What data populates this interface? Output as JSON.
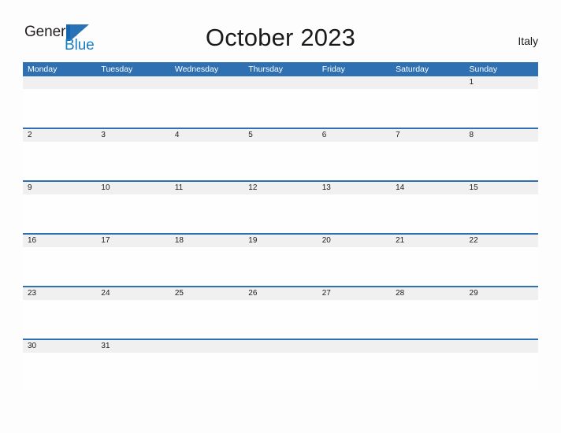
{
  "brand": {
    "word_one": "General",
    "word_two": "Blue",
    "mark": "triangle-flag-logo"
  },
  "header": {
    "title": "October 2023",
    "country": "Italy"
  },
  "colors": {
    "header_blue": "#2f70b3",
    "divider_blue": "#2f70b3",
    "number_band_gray": "#f0f0f0",
    "logo_blue": "#1a7fc1",
    "text_dark": "#1a1a1a"
  },
  "calendar": {
    "month": "October",
    "year": "2023",
    "week_start": "Monday",
    "day_headers": [
      "Monday",
      "Tuesday",
      "Wednesday",
      "Thursday",
      "Friday",
      "Saturday",
      "Sunday"
    ],
    "weeks": [
      [
        "",
        "",
        "",
        "",
        "",
        "",
        "1"
      ],
      [
        "2",
        "3",
        "4",
        "5",
        "6",
        "7",
        "8"
      ],
      [
        "9",
        "10",
        "11",
        "12",
        "13",
        "14",
        "15"
      ],
      [
        "16",
        "17",
        "18",
        "19",
        "20",
        "21",
        "22"
      ],
      [
        "23",
        "24",
        "25",
        "26",
        "27",
        "28",
        "29"
      ],
      [
        "30",
        "31",
        "",
        "",
        "",
        "",
        ""
      ]
    ]
  }
}
